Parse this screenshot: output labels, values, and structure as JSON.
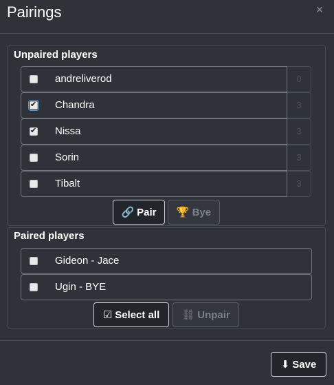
{
  "modal": {
    "title": "Pairings",
    "close_icon": "×"
  },
  "unpaired": {
    "title": "Unpaired players",
    "players": [
      {
        "name": "andreliverod",
        "score": "0",
        "checked": false
      },
      {
        "name": "Chandra",
        "score": "3",
        "checked": true
      },
      {
        "name": "Nissa",
        "score": "3",
        "checked": true
      },
      {
        "name": "Sorin",
        "score": "3",
        "checked": false
      },
      {
        "name": "Tibalt",
        "score": "3",
        "checked": false
      }
    ],
    "pair_label": "Pair",
    "bye_label": "Bye"
  },
  "paired": {
    "title": "Paired players",
    "pairs": [
      {
        "label": "Gideon - Jace",
        "checked": false
      },
      {
        "label": "Ugin - BYE",
        "checked": false
      }
    ],
    "select_all_label": "Select all",
    "unpair_label": "Unpair"
  },
  "footer": {
    "save_label": "Save"
  },
  "icons": {
    "pair": "link-icon",
    "bye": "trophy-icon",
    "select_all": "check-square-icon",
    "unpair": "unlink-icon",
    "save": "download-icon",
    "close": "close-icon"
  }
}
